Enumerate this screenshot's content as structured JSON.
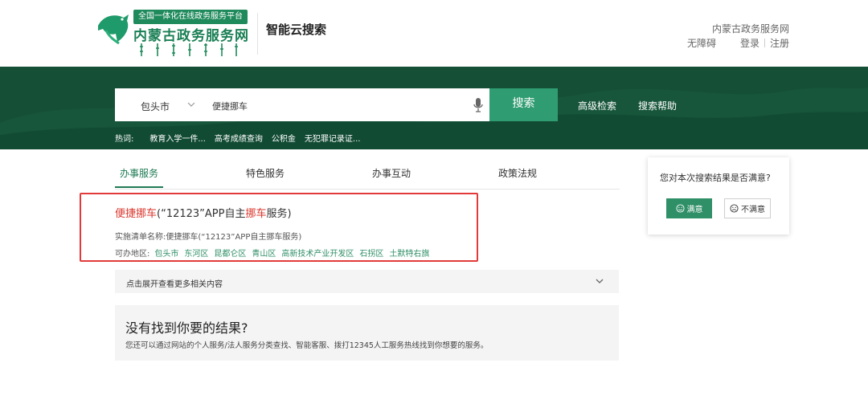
{
  "header": {
    "logo_banner": "全国一体化在线政务服务平台",
    "logo_name": "内蒙古政务服务网",
    "site_title": "智能云搜索",
    "right_name": "内蒙古政务服务网",
    "accessibility": "无障碍",
    "login": "登录",
    "register": "注册"
  },
  "search": {
    "city": "包头市",
    "query": "便捷挪车",
    "button": "搜索",
    "advanced": "高级检索",
    "help": "搜索帮助",
    "hot_label": "热词:",
    "hot_words": [
      "教育入学一件...",
      "高考成绩查询",
      "公积金",
      "无犯罪记录证..."
    ]
  },
  "tabs": [
    {
      "label": "办事服务",
      "active": true
    },
    {
      "label": "特色服务",
      "active": false
    },
    {
      "label": "办事互动",
      "active": false
    },
    {
      "label": "政策法规",
      "active": false
    }
  ],
  "result": {
    "title_parts": [
      {
        "text": "便捷挪车",
        "hl": true
      },
      {
        "text": "(“12123”APP自主",
        "hl": false
      },
      {
        "text": "挪车",
        "hl": true
      },
      {
        "text": "服务)",
        "hl": false
      }
    ],
    "meta": "实施清单名称:便捷挪车(“12123”APP自主挪车服务)",
    "regions_label": "可办地区:",
    "regions": [
      "包头市",
      "东河区",
      "昆都仑区",
      "青山区",
      "高新技术产业开发区",
      "石拐区",
      "土默特右旗"
    ]
  },
  "expand": {
    "label": "点击展开查看更多相关内容"
  },
  "no_result": {
    "title": "没有找到你要的结果?",
    "desc": "您还可以通过网站的个人服务/法人服务分类查找、智能客服、拨打12345人工服务热线找到你想要的服务。"
  },
  "satisfaction": {
    "question": "您对本次搜索结果是否满意?",
    "yes": "满意",
    "no": "不满意"
  },
  "colors": {
    "brand_green": "#154f36",
    "button_green": "#2f9c72",
    "highlight_red": "#d9352b",
    "link_green": "#2f8f67"
  }
}
